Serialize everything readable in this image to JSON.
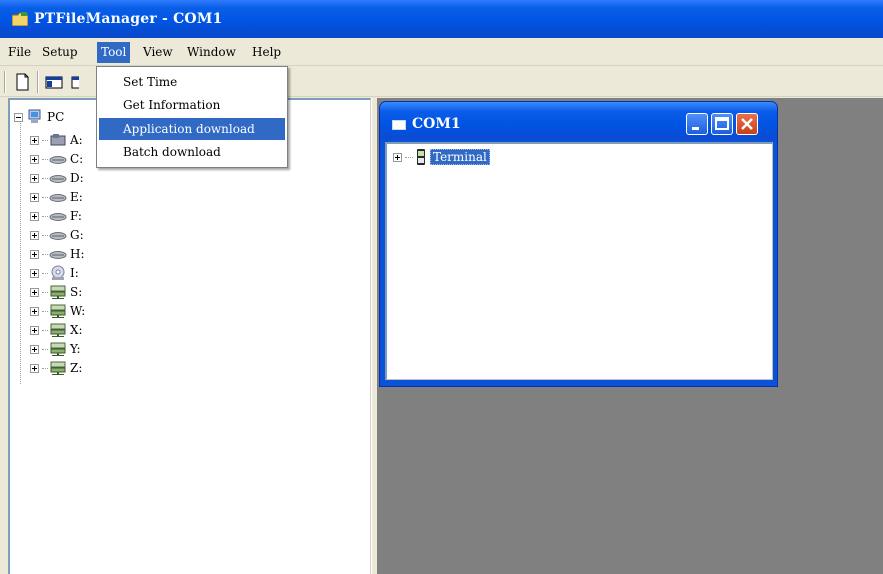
{
  "window": {
    "title": "PTFileManager - COM1",
    "icon": "folder-app-icon"
  },
  "menubar": {
    "items": [
      "File",
      "Setup",
      "Tool",
      "View",
      "Window",
      "Help"
    ],
    "active": "Tool"
  },
  "toolbar": {
    "buttons": [
      "new-document-icon",
      "view-layout-icon",
      "view-toggle-icon"
    ]
  },
  "tool_menu": {
    "items": [
      "Set Time",
      "Get Information",
      "Application download",
      "Batch download"
    ],
    "highlighted": "Application download"
  },
  "tree": {
    "root": {
      "label": "PC",
      "icon": "computer-icon"
    },
    "drives": [
      {
        "label": "A:",
        "icon": "floppy-drive-icon"
      },
      {
        "label": "C:",
        "icon": "hard-drive-icon"
      },
      {
        "label": "D:",
        "icon": "hard-drive-icon"
      },
      {
        "label": "E:",
        "icon": "hard-drive-icon"
      },
      {
        "label": "F:",
        "icon": "hard-drive-icon"
      },
      {
        "label": "G:",
        "icon": "hard-drive-icon"
      },
      {
        "label": "H:",
        "icon": "hard-drive-icon"
      },
      {
        "label": "I:",
        "icon": "cd-drive-icon"
      },
      {
        "label": "S:",
        "icon": "network-drive-icon"
      },
      {
        "label": "W:",
        "icon": "network-drive-icon"
      },
      {
        "label": "X:",
        "icon": "network-drive-icon"
      },
      {
        "label": "Y:",
        "icon": "network-drive-icon"
      },
      {
        "label": "Z:",
        "icon": "network-drive-icon"
      }
    ]
  },
  "child_window": {
    "title": "COM1",
    "node": {
      "label": "Terminal",
      "icon": "handheld-terminal-icon"
    }
  },
  "colors": {
    "title_blue": "#0054e3",
    "selection": "#316ac5",
    "close_button": "#c8401a",
    "mdi_background": "#808080"
  }
}
